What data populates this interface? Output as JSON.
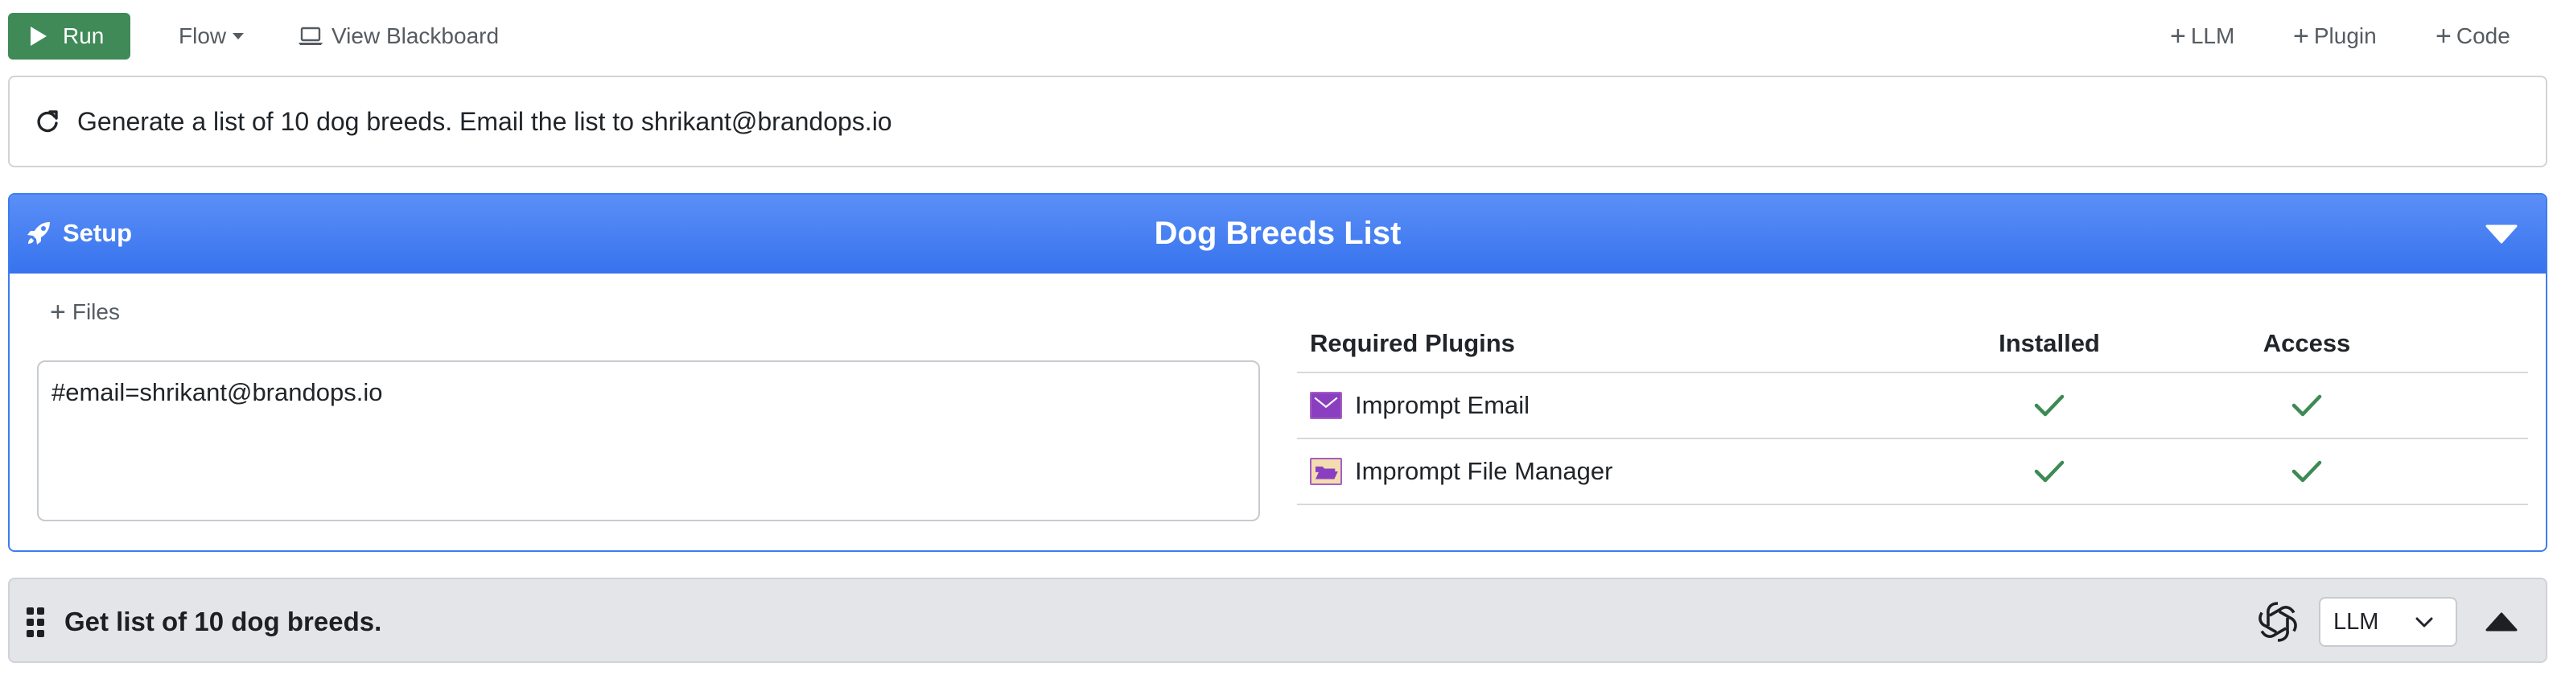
{
  "toolbar": {
    "run_label": "Run",
    "flow_label": "Flow",
    "blackboard_label": "View Blackboard",
    "add_llm_label": "LLM",
    "add_plugin_label": "Plugin",
    "add_code_label": "Code",
    "run_color": "#3f8a57"
  },
  "prompt": {
    "text": "Generate a list of 10 dog breeds. Email the list to shrikant@brandops.io"
  },
  "setup": {
    "label": "Setup",
    "title": "Dog Breeds List",
    "accent_color": "#3d7df0",
    "files_label": "Files",
    "context_text": "#email=shrikant@brandops.io",
    "plugins_table": {
      "headers": [
        "Required Plugins",
        "Installed",
        "Access"
      ],
      "rows": [
        {
          "name": "Imprompt Email",
          "icon": "envelope-icon",
          "installed": true,
          "access": true
        },
        {
          "name": "Imprompt File Manager",
          "icon": "folder-open-icon",
          "installed": true,
          "access": true
        }
      ]
    }
  },
  "step": {
    "title": "Get list of 10 dog breeds.",
    "model_icon": "openai-icon",
    "model_value": "LLM"
  }
}
